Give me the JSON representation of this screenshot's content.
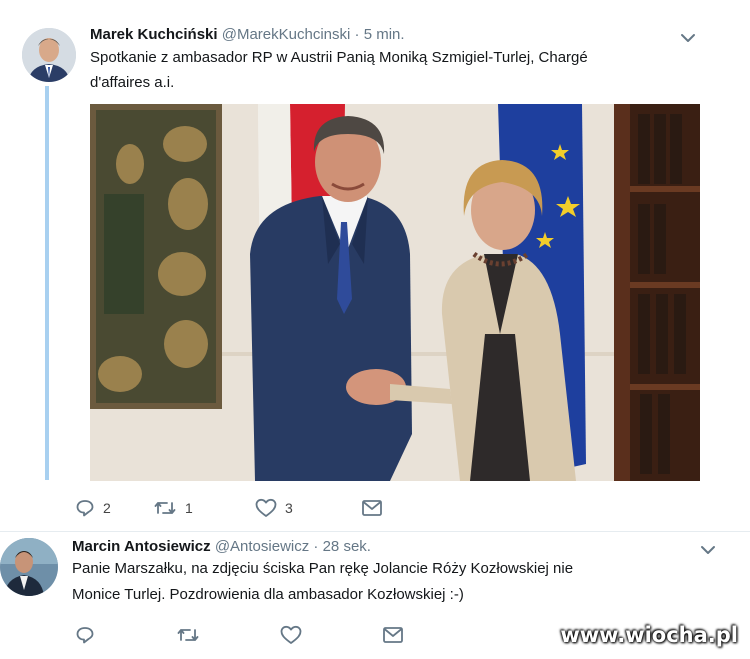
{
  "tweets": [
    {
      "name": "Marek Kuchciński",
      "handle": "@MarekKuchcinski",
      "dot": "·",
      "time": "5 min.",
      "text_line1": "Spotkanie z ambasador RP w Austrii Panią Moniką Szmigiel-Turlej, Chargé",
      "text_line2": "d'affaires a.i.",
      "replies": "2",
      "retweets": "1",
      "likes": "3"
    },
    {
      "name": "Marcin Antosiewicz",
      "handle": "@Antosiewicz",
      "dot": "·",
      "time": "28 sek.",
      "text_line1": "Panie Marszałku, na zdjęciu ściska Pan rękę Jolancie Róży Kozłowskiej nie",
      "text_line2": "Monice Turlej. Pozdrowienia dla ambasador Kozłowskiej :-)"
    }
  ],
  "icons": [
    "reply-icon",
    "retweet-icon",
    "like-icon",
    "message-icon",
    "chevron-down-icon"
  ],
  "colors": {
    "icon": "#657786",
    "thread_line": "#a8d0f0",
    "text": "#14171a"
  },
  "watermark": "www.wiocha.pl"
}
